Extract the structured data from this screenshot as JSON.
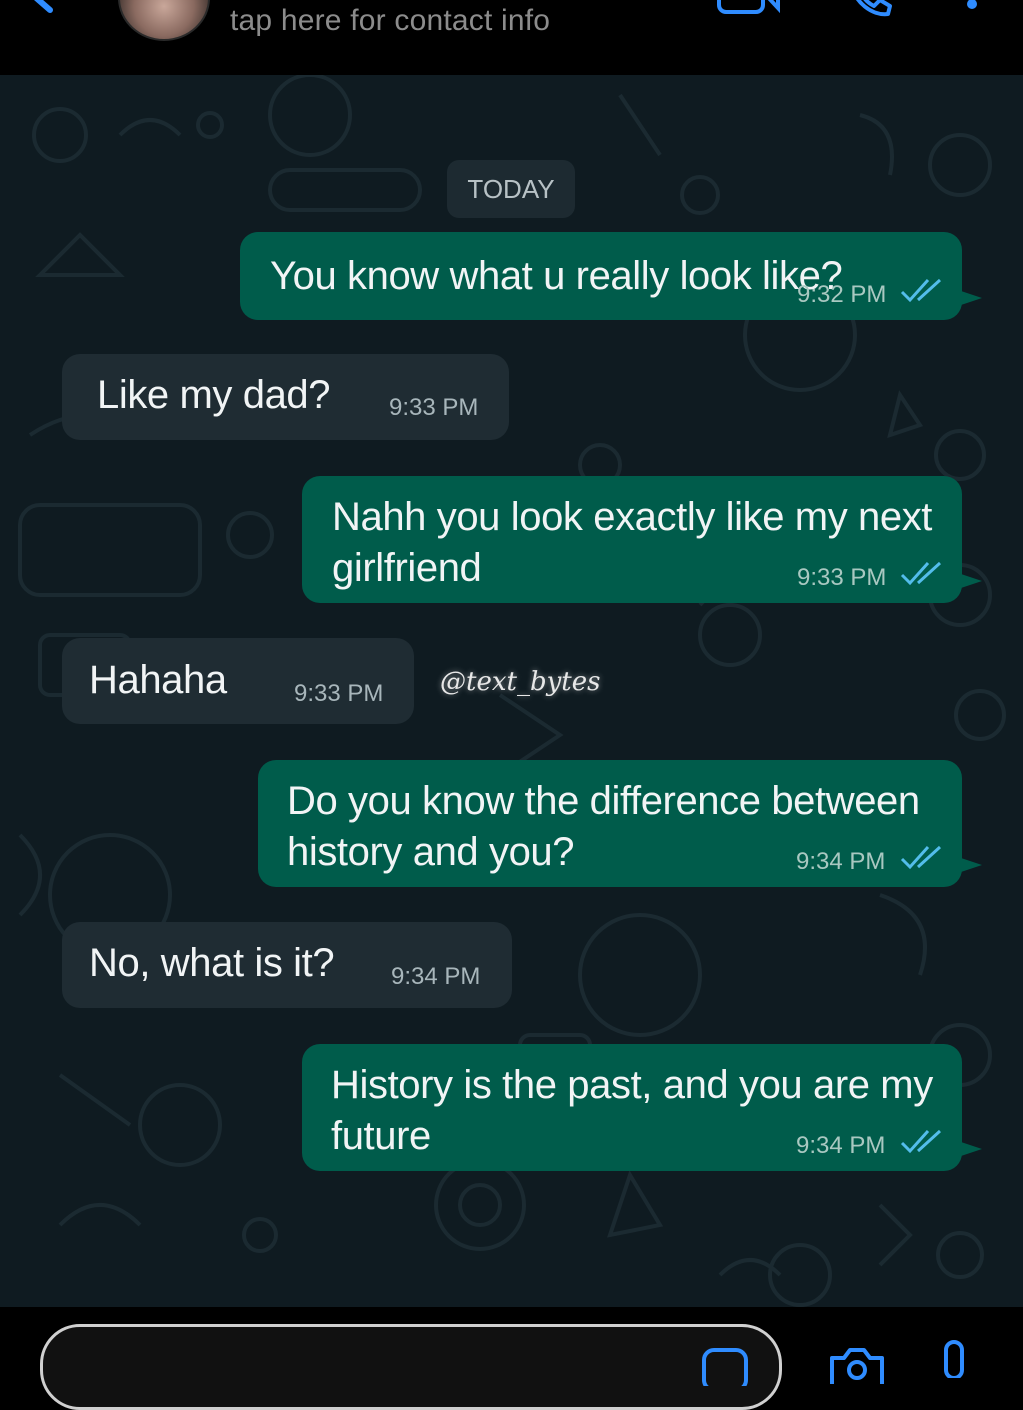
{
  "header": {
    "contact_info": "tap here for contact info",
    "icons": [
      "back-icon",
      "avatar",
      "video-call-icon",
      "voice-call-icon",
      "more-icon"
    ]
  },
  "chat": {
    "day_label": "TODAY",
    "watermark": "@text_bytes",
    "messages": [
      {
        "direction": "out",
        "text": "You know what u really look like?",
        "time": "9:32 PM",
        "status": "read"
      },
      {
        "direction": "in",
        "text": "Like my dad?",
        "time": "9:33 PM"
      },
      {
        "direction": "out",
        "text": "Nahh you look exactly like my next girlfriend",
        "time": "9:33 PM",
        "status": "read"
      },
      {
        "direction": "in",
        "text": "Hahaha",
        "time": "9:33 PM"
      },
      {
        "direction": "out",
        "text": "Do you know the difference between history and you?",
        "time": "9:34 PM",
        "status": "read"
      },
      {
        "direction": "in",
        "text": "No, what is it?",
        "time": "9:34 PM"
      },
      {
        "direction": "out",
        "text": "History is the past, and you are my future",
        "time": "9:34 PM",
        "status": "read"
      }
    ]
  },
  "footer": {
    "icons": [
      "sticker-icon",
      "camera-icon",
      "microphone-icon"
    ]
  },
  "colors": {
    "accent": "#2f8cff",
    "outgoing_bubble": "#005c4b",
    "incoming_bubble": "#1f2c33",
    "chat_background": "#0f1b21",
    "read_tick": "#53bdeb"
  }
}
